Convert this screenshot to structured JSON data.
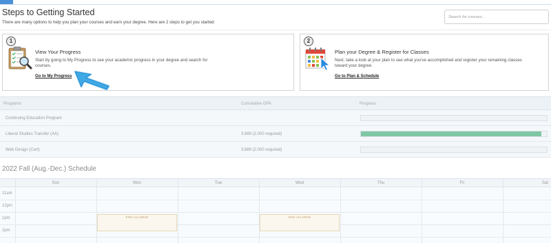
{
  "colors": {
    "accent": "#4a90d9",
    "progress_fill": "#80c6a4"
  },
  "header": {
    "title": "Steps to Getting Started",
    "intro": "There are many options to help you plan your courses and earn your degree. Here are 2 steps to get you started:",
    "search": {
      "placeholder": "Search for courses..."
    }
  },
  "steps": [
    {
      "number": "1",
      "icon": "clipboard-magnifier-icon",
      "title": "View Your Progress",
      "description": "Start by going to My Progress to see your academic progress in your degree and search for courses.",
      "link": "Go to My Progress"
    },
    {
      "number": "2",
      "icon": "calendar-icon",
      "title": "Plan your Degree & Register for Classes",
      "description": "Next, take a look at your plan to see what you've accomplished and register your remaining classes toward your degree.",
      "link": "Go to Plan & Schedule"
    }
  ],
  "programs": {
    "columns": {
      "program": "Programs",
      "gpa": "Cumulative GPA",
      "progress": "Progress"
    },
    "rows": [
      {
        "name": "Continuing Education Program",
        "gpa": "",
        "progress": 0
      },
      {
        "name": "Liberal Studies Transfer (AA)",
        "gpa": "3.889 (2.000 required)",
        "progress": 0.97
      },
      {
        "name": "Web Design (Cert)",
        "gpa": "3.889 (2.000 required)",
        "progress": 0
      }
    ]
  },
  "schedule": {
    "title": "2022 Fall (Aug.-Dec.) Schedule",
    "days": [
      "Sun",
      "Mon",
      "Tue",
      "Wed",
      "Thu",
      "Fri",
      "Sat"
    ],
    "times": [
      "11am",
      "12pm",
      "1pm",
      "2pm"
    ],
    "events": [
      {
        "label": "ENG 111.M01B",
        "day": 1,
        "start_hour": 13.17,
        "end_hour": 14.58
      },
      {
        "label": "ENG 111.M01B",
        "day": 3,
        "start_hour": 13.17,
        "end_hour": 14.58
      }
    ]
  }
}
